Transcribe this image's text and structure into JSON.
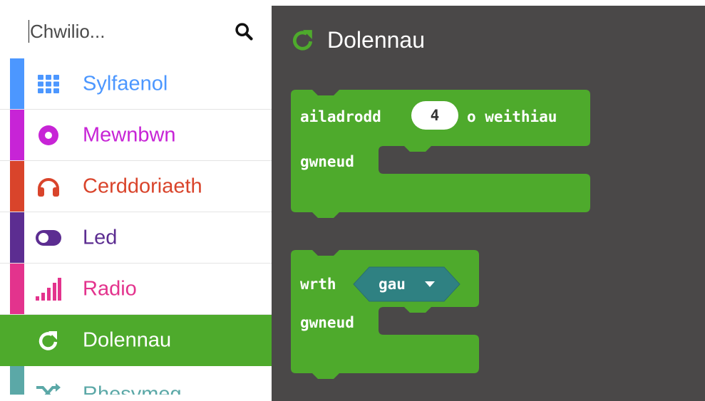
{
  "search": {
    "placeholder": "Chwilio...",
    "icon": "search-icon"
  },
  "categories": [
    {
      "label": "Sylfaenol",
      "color": "#4c97ff",
      "icon": "grid-icon"
    },
    {
      "label": "Mewnbwn",
      "color": "#c724d6",
      "icon": "input-circle-icon"
    },
    {
      "label": "Cerddoriaeth",
      "color": "#d9442b",
      "icon": "headphones-icon"
    },
    {
      "label": "Led",
      "color": "#5c2d91",
      "icon": "toggle-icon"
    },
    {
      "label": "Radio",
      "color": "#e3338d",
      "icon": "signal-bars-icon"
    },
    {
      "label": "Dolennau",
      "color": "#4eaa2c",
      "icon": "loop-icon"
    },
    {
      "label": "Rhesymeg",
      "color": "#5ba8a7",
      "icon": "shuffle-icon"
    }
  ],
  "active_category": "Dolennau",
  "flyout": {
    "title": "Dolennau",
    "title_icon": "loop-icon",
    "background": "#4a4848",
    "block_color": "#4eaa2c",
    "blocks": [
      {
        "head_label": "ailadrodd",
        "count_value": "4",
        "tail_label": "o weithiau",
        "body_label": "gwneud"
      },
      {
        "head_label": "wrth",
        "condition_value": "gau",
        "condition_color": "#2f8182",
        "body_label": "gwneud"
      }
    ]
  }
}
